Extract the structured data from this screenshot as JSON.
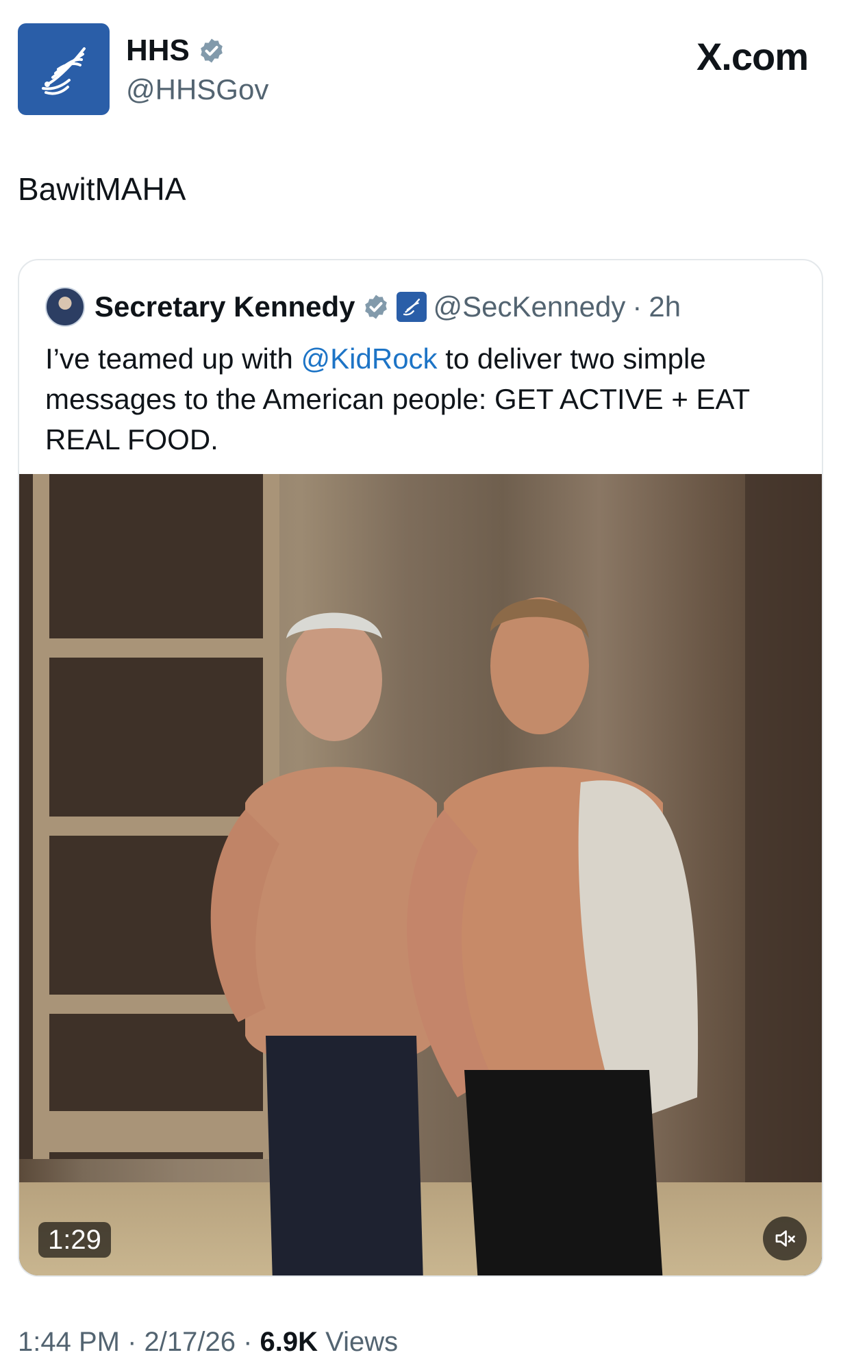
{
  "tweet": {
    "author": {
      "name": "HHS",
      "handle": "@HHSGov"
    },
    "site": "X.com",
    "text": "BawitMAHA",
    "quote": {
      "author_name": "Secretary Kennedy",
      "handle": "@SecKennedy",
      "separator": "·",
      "age": "2h",
      "text_before": "I’ve teamed up with ",
      "mention": "@KidRock",
      "text_after": " to deliver two simple messages to the American people: GET ACTIVE + EAT REAL FOOD.",
      "video": {
        "duration": "1:29",
        "muted_icon": "speaker-muted-icon"
      }
    },
    "meta": {
      "time": "1:44 PM",
      "sep1": " · ",
      "date": "2/17/26",
      "sep2": " · ",
      "views_count": "6.9K",
      "views_label": " Views"
    }
  },
  "colors": {
    "accent": "#1d74c6",
    "hhs_blue": "#2a5ea8",
    "secondary_text": "#536471",
    "verified": "#829aab"
  }
}
